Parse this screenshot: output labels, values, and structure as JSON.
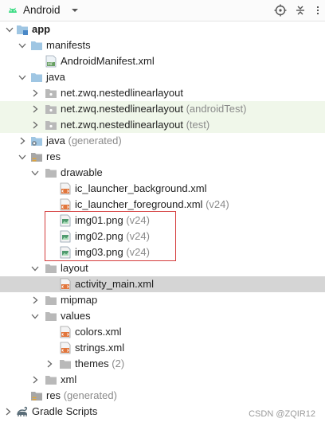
{
  "toolbar": {
    "title": "Android"
  },
  "tree": [
    {
      "label": "app",
      "bold": true
    },
    {
      "label": "manifests"
    },
    {
      "label": "AndroidManifest.xml"
    },
    {
      "label": "java"
    },
    {
      "label": "net.zwq.nestedlinearlayout"
    },
    {
      "label": "net.zwq.nestedlinearlayout",
      "suffix": "(androidTest)"
    },
    {
      "label": "net.zwq.nestedlinearlayout",
      "suffix": "(test)"
    },
    {
      "label": "java",
      "suffix": "(generated)"
    },
    {
      "label": "res"
    },
    {
      "label": "drawable"
    },
    {
      "label": "ic_launcher_background.xml"
    },
    {
      "label": "ic_launcher_foreground.xml",
      "suffix": "(v24)"
    },
    {
      "label": "img01.png",
      "suffix": "(v24)"
    },
    {
      "label": "img02.png",
      "suffix": "(v24)"
    },
    {
      "label": "img03.png",
      "suffix": "(v24)"
    },
    {
      "label": "layout"
    },
    {
      "label": "activity_main.xml"
    },
    {
      "label": "mipmap"
    },
    {
      "label": "values"
    },
    {
      "label": "colors.xml"
    },
    {
      "label": "strings.xml"
    },
    {
      "label": "themes",
      "suffix": "(2)"
    },
    {
      "label": "xml"
    },
    {
      "label": "res",
      "suffix": "(generated)"
    },
    {
      "label": "Gradle Scripts"
    }
  ],
  "watermark": "CSDN @ZQIR12",
  "colors": {
    "selection": "#d5d5d5",
    "highlight_border": "#d43c3c",
    "test_row_bg": "#f0f7ea"
  }
}
